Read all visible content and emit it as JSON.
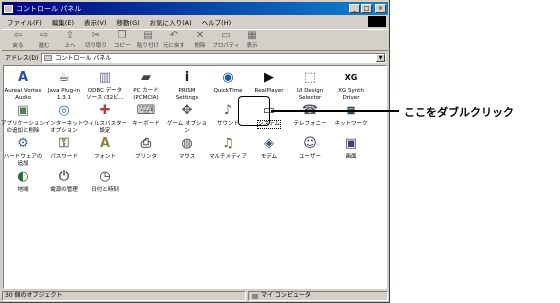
{
  "window": {
    "title": "コントロール パネル",
    "controls": [
      "_",
      "□",
      "×"
    ]
  },
  "menu": [
    "ファイル(F)",
    "編集(E)",
    "表示(V)",
    "移動(G)",
    "お気に入り(A)",
    "ヘルプ(H)"
  ],
  "toolbar": [
    {
      "label": "戻る",
      "icon": "back-arrow"
    },
    {
      "label": "進む",
      "icon": "forward-arrow"
    },
    {
      "label": "上へ",
      "icon": "up-folder"
    },
    {
      "label": "切り取り",
      "icon": "scissors"
    },
    {
      "label": "コピー",
      "icon": "copy"
    },
    {
      "label": "貼り付け",
      "icon": "paste"
    },
    {
      "label": "元に戻す",
      "icon": "undo"
    },
    {
      "label": "削除",
      "icon": "delete-x"
    },
    {
      "label": "プロパティ",
      "icon": "properties"
    },
    {
      "label": "表示",
      "icon": "views"
    }
  ],
  "address": {
    "label": "アドレス(D)",
    "value": "コントロール パネル"
  },
  "items": [
    {
      "label": "Aureal Vortex\nAudio",
      "icon": "audio"
    },
    {
      "label": "Java Plug-in\n1.3.1",
      "icon": "java"
    },
    {
      "label": "ODBC データ\nソース (32ビ...",
      "icon": "odbc"
    },
    {
      "label": "PC カード\n(PCMCIA)",
      "icon": "pccard"
    },
    {
      "label": "PRISM\nSettings",
      "icon": "info"
    },
    {
      "label": "QuickTime",
      "icon": "quicktime"
    },
    {
      "label": "RealPlayer",
      "icon": "realplayer"
    },
    {
      "label": "UI Design\nSelector",
      "icon": "uidesign"
    },
    {
      "label": "XG Synth\nDriver",
      "icon": "xgsoft"
    },
    {
      "label": "アプリケーション\nの追加と削除",
      "icon": "addremove"
    },
    {
      "label": "インターネット\nオプション",
      "icon": "internet"
    },
    {
      "label": "ウィルスバスター\n設定",
      "icon": "virus"
    },
    {
      "label": "キーボード",
      "icon": "keyboard"
    },
    {
      "label": "ゲーム オプション",
      "icon": "game"
    },
    {
      "label": "サウンド",
      "icon": "sound"
    },
    {
      "label": "システム",
      "icon": "system"
    },
    {
      "label": "テレフォニー",
      "icon": "telephony"
    },
    {
      "label": "ネットワーク",
      "icon": "network"
    },
    {
      "label": "ハードウェアの\n追加",
      "icon": "hardware"
    },
    {
      "label": "パスワード",
      "icon": "password"
    },
    {
      "label": "フォント",
      "icon": "fonts"
    },
    {
      "label": "プリンタ",
      "icon": "printers"
    },
    {
      "label": "マウス",
      "icon": "mouse"
    },
    {
      "label": "マルチメディア",
      "icon": "multimedia"
    },
    {
      "label": "モデム",
      "icon": "modem"
    },
    {
      "label": "ユーザー",
      "icon": "users"
    },
    {
      "label": "画面",
      "icon": "display"
    },
    {
      "label": "地域",
      "icon": "regional"
    },
    {
      "label": "電源の管理",
      "icon": "power"
    },
    {
      "label": "日付と時刻",
      "icon": "datetime"
    }
  ],
  "status": {
    "count": "30 個のオブジェクト",
    "zone": "マイ コンピュータ"
  },
  "callout": "ここをダブルクリック"
}
